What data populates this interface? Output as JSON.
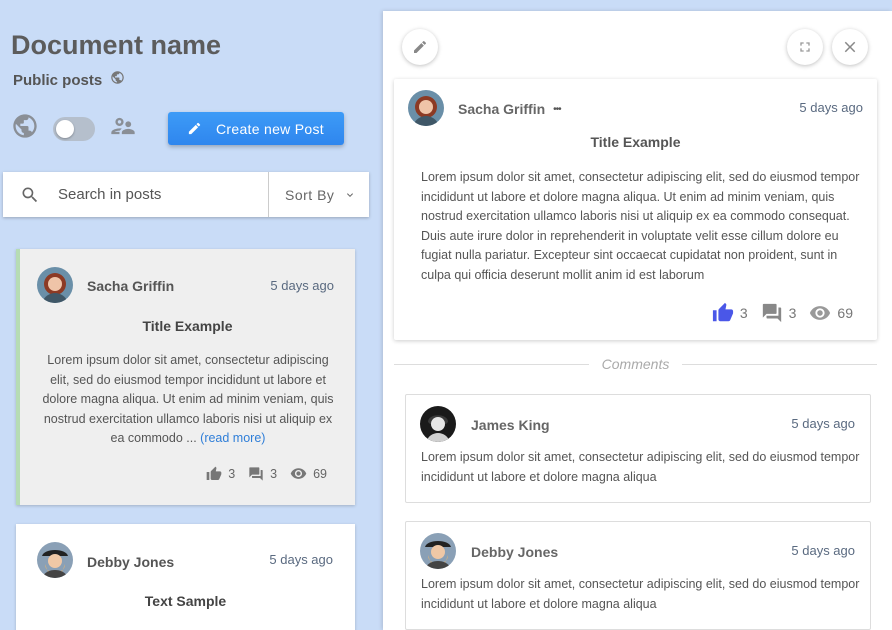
{
  "document": {
    "title": "Document name",
    "visibility_label": "Public posts"
  },
  "toolbar": {
    "create_label": "Create new Post"
  },
  "search": {
    "placeholder": "Search in posts",
    "sort_label": "Sort By"
  },
  "posts": [
    {
      "author": "Sacha Griffin",
      "time": "5 days ago",
      "title": "Title Example",
      "excerpt": "Lorem ipsum dolor sit amet, consectetur adipiscing elit, sed do eiusmod tempor incididunt ut labore et dolore magna aliqua. Ut enim ad minim veniam, quis nostrud exercitation ullamco laboris nisi ut aliquip ex ea commodo ... ",
      "read_more": "(read more)",
      "likes": "3",
      "comments": "3",
      "views": "69"
    },
    {
      "author": "Debby Jones",
      "time": "5 days ago",
      "title": "Text Sample"
    }
  ],
  "detail": {
    "author": "Sacha Griffin",
    "more": "•••",
    "time": "5 days ago",
    "title": "Title Example",
    "body": "Lorem ipsum dolor sit amet, consectetur adipiscing elit, sed do eiusmod tempor incididunt ut labore et dolore magna aliqua. Ut enim ad minim veniam, quis nostrud exercitation ullamco laboris nisi ut aliquip ex ea commodo consequat. Duis aute irure dolor in reprehenderit in voluptate velit esse cillum dolore eu fugiat nulla pariatur. Excepteur sint occaecat cupidatat non proident, sunt in culpa qui officia deserunt mollit anim id est laborum",
    "likes": "3",
    "comments": "3",
    "views": "69",
    "like_color": "#4a57e8"
  },
  "comments_label": "Comments",
  "comments": [
    {
      "author": "James King",
      "time": "5 days ago",
      "body": "Lorem ipsum dolor sit amet, consectetur adipiscing elit, sed do eiusmod tempor incididunt ut labore et dolore magna aliqua"
    },
    {
      "author": "Debby Jones",
      "time": "5 days ago",
      "body": "Lorem ipsum dolor sit amet, consectetur adipiscing elit, sed do eiusmod tempor incididunt ut labore et dolore magna aliqua"
    }
  ],
  "colors": {
    "background": "#c9dcf7",
    "primary_button": "#3590f3",
    "active_marker": "#b6dcb4",
    "link": "#2f7ed8"
  }
}
